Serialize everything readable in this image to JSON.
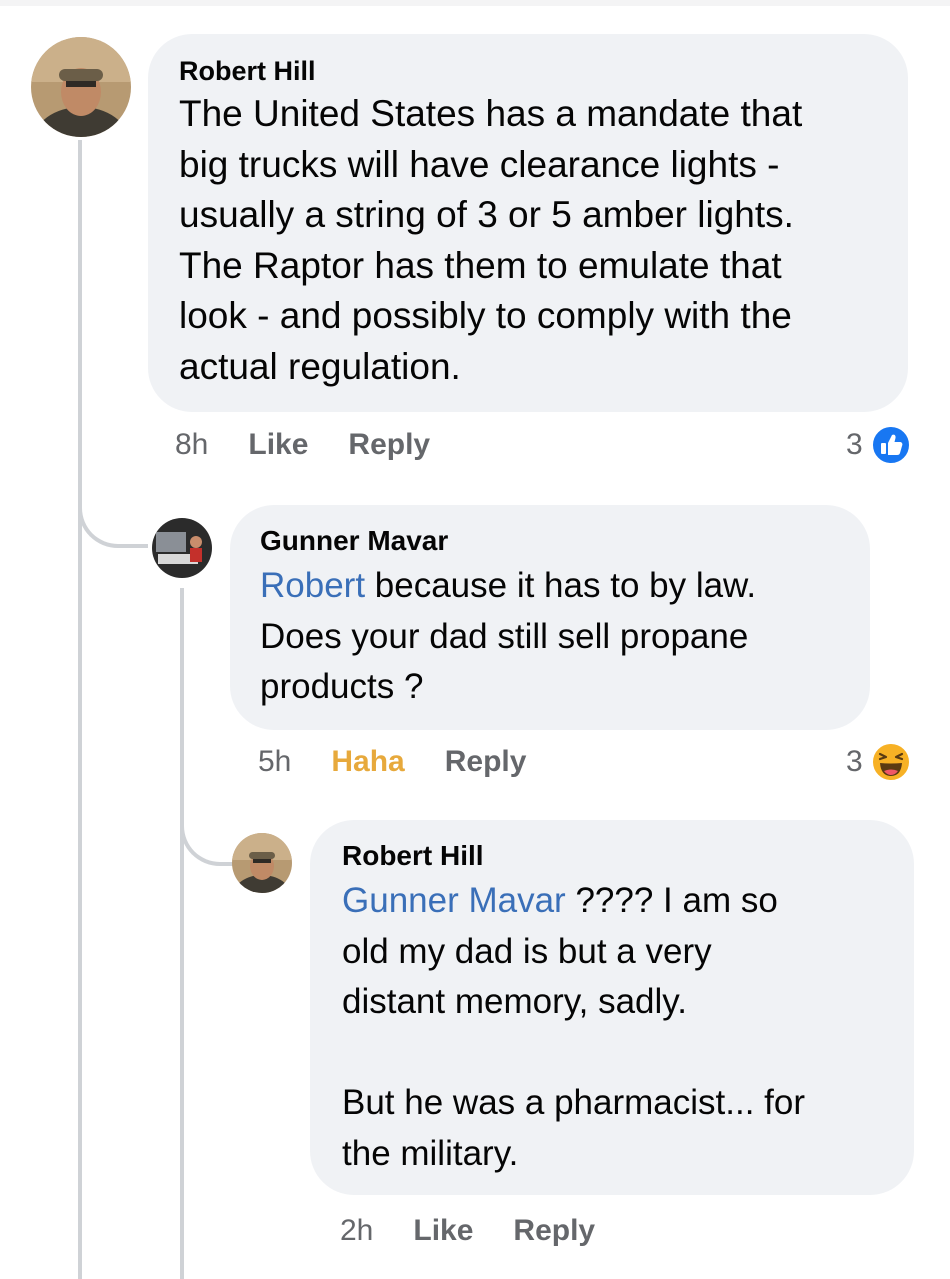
{
  "comments": [
    {
      "author": "Robert Hill",
      "text": "The United States has a mandate that\nbig trucks will have clearance lights -\nusually a string of 3 or 5 amber lights.\nThe Raptor has them to emulate that\nlook - and possibly to comply with the\nactual regulation.",
      "time": "8h",
      "action1": "Like",
      "action2": "Reply",
      "reaction_count": "3",
      "reaction_icon": "like-icon",
      "reaction_color": "#1877f2"
    },
    {
      "author": "Gunner Mavar",
      "mention": "Robert",
      "text": " because it has to by law.\nDoes your dad still sell propane\nproducts ?",
      "time": "5h",
      "action1": "Haha",
      "action2": "Reply",
      "action1_color": "#e7a93c",
      "reaction_count": "3",
      "reaction_icon": "haha-icon",
      "reaction_color": "#f7b125"
    },
    {
      "author": "Robert Hill",
      "mention": "Gunner Mavar",
      "text": " ????   I am so\nold my dad is but a very\ndistant memory, sadly.\n\nBut he was a pharmacist... for\nthe military.",
      "time": "2h",
      "action1": "Like",
      "action2": "Reply"
    }
  ],
  "colors": {
    "bubble": "#f0f2f5",
    "mention": "#3a6fb8",
    "meta_text": "#65676b",
    "thread_line": "#cfd2d6"
  }
}
